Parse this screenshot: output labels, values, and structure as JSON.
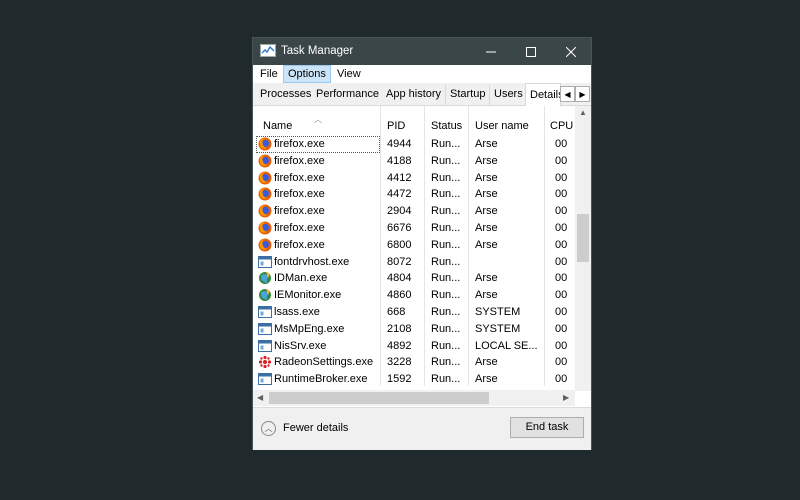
{
  "window": {
    "title": "Task Manager",
    "controls": {
      "minimize": "—",
      "maximize": "☐",
      "close": "✕"
    }
  },
  "menu": [
    {
      "label": "File",
      "active": false
    },
    {
      "label": "Options",
      "active": true
    },
    {
      "label": "View",
      "active": false
    }
  ],
  "tabs": [
    {
      "label": "Processes"
    },
    {
      "label": "Performance"
    },
    {
      "label": "App history"
    },
    {
      "label": "Startup"
    },
    {
      "label": "Users"
    },
    {
      "label": "Details",
      "active": true
    }
  ],
  "columns": [
    "Name",
    "PID",
    "Status",
    "User name",
    "CPU"
  ],
  "rows": [
    {
      "name": "firefox.exe",
      "pid": "4944",
      "status": "Run...",
      "user": "Arse",
      "cpu": "00",
      "icon": "firefox-icon",
      "selected": true
    },
    {
      "name": "firefox.exe",
      "pid": "4188",
      "status": "Run...",
      "user": "Arse",
      "cpu": "00",
      "icon": "firefox-icon"
    },
    {
      "name": "firefox.exe",
      "pid": "4412",
      "status": "Run...",
      "user": "Arse",
      "cpu": "00",
      "icon": "firefox-icon"
    },
    {
      "name": "firefox.exe",
      "pid": "4472",
      "status": "Run...",
      "user": "Arse",
      "cpu": "00",
      "icon": "firefox-icon"
    },
    {
      "name": "firefox.exe",
      "pid": "2904",
      "status": "Run...",
      "user": "Arse",
      "cpu": "00",
      "icon": "firefox-icon"
    },
    {
      "name": "firefox.exe",
      "pid": "6676",
      "status": "Run...",
      "user": "Arse",
      "cpu": "00",
      "icon": "firefox-icon"
    },
    {
      "name": "firefox.exe",
      "pid": "6800",
      "status": "Run...",
      "user": "Arse",
      "cpu": "00",
      "icon": "firefox-icon"
    },
    {
      "name": "fontdrvhost.exe",
      "pid": "8072",
      "status": "Run...",
      "user": "",
      "cpu": "00",
      "icon": "window-app-icon"
    },
    {
      "name": "IDMan.exe",
      "pid": "4804",
      "status": "Run...",
      "user": "Arse",
      "cpu": "00",
      "icon": "idm-globe-icon"
    },
    {
      "name": "IEMonitor.exe",
      "pid": "4860",
      "status": "Run...",
      "user": "Arse",
      "cpu": "00",
      "icon": "idm-globe-icon"
    },
    {
      "name": "lsass.exe",
      "pid": "668",
      "status": "Run...",
      "user": "SYSTEM",
      "cpu": "00",
      "icon": "window-app-icon"
    },
    {
      "name": "MsMpEng.exe",
      "pid": "2108",
      "status": "Run...",
      "user": "SYSTEM",
      "cpu": "00",
      "icon": "window-app-icon"
    },
    {
      "name": "NisSrv.exe",
      "pid": "4892",
      "status": "Run...",
      "user": "LOCAL SE...",
      "cpu": "00",
      "icon": "window-app-icon"
    },
    {
      "name": "RadeonSettings.exe",
      "pid": "3228",
      "status": "Run...",
      "user": "Arse",
      "cpu": "00",
      "icon": "radeon-icon"
    },
    {
      "name": "RuntimeBroker.exe",
      "pid": "1592",
      "status": "Run...",
      "user": "Arse",
      "cpu": "00",
      "icon": "window-app-icon"
    }
  ],
  "footer": {
    "fewer_details": "Fewer details",
    "end_task": "End task"
  }
}
